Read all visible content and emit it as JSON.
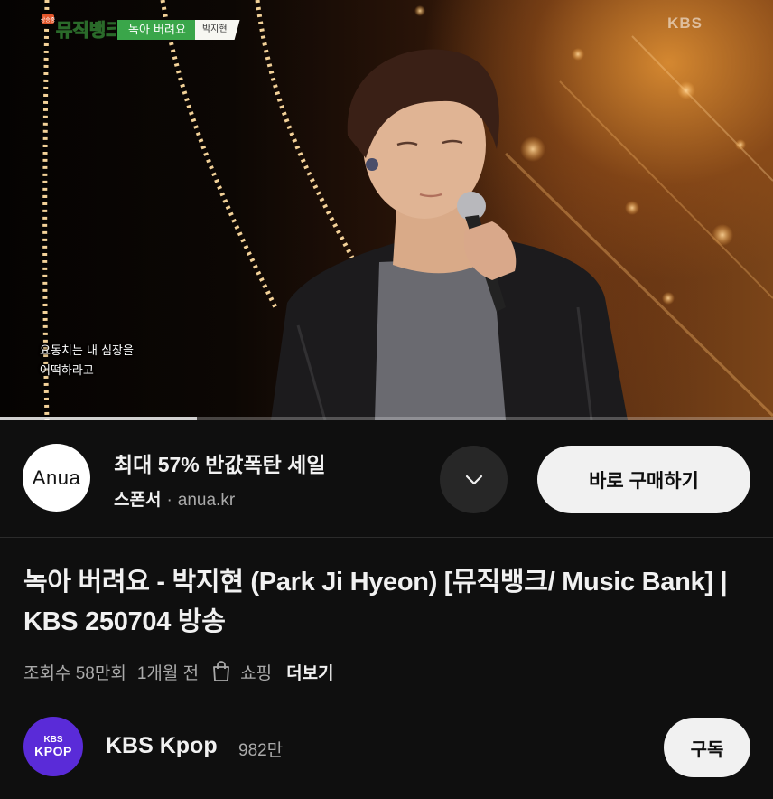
{
  "player": {
    "show_logo_text": "뮤직뱅크",
    "show_logo_badge": "상승중",
    "song_tag_title": "녹아 버려요",
    "song_tag_artist": "박지현",
    "broadcaster_mark": "KBS",
    "lyrics_line1": "요동치는 내 심장을",
    "lyrics_line2": "어떡하라고",
    "progress_fraction": 0.255
  },
  "ad": {
    "logo_text": "Anua",
    "headline": "최대 57% 반값폭탄 세일",
    "sponsor_label": "스폰서",
    "separator": "·",
    "domain": "anua.kr",
    "expand_icon": "chevron-down-icon",
    "cta_label": "바로 구매하기"
  },
  "video": {
    "title": "녹아 버려요 - 박지현 (Park Ji Hyeon) [뮤직뱅크/ Music Bank] | KBS 250704 방송",
    "views": "조회수 58만회",
    "age": "1개월 전",
    "shopping_icon": "shopping-bag-icon",
    "shopping_label": "쇼핑",
    "more_label": "더보기"
  },
  "channel": {
    "avatar_line1": "KBS",
    "avatar_line2": "KPOP",
    "avatar_color": "#5a2bd8",
    "name": "KBS Kpop",
    "subscribers": "982만",
    "subscribe_label": "구독"
  },
  "colors": {
    "background": "#0f0f0f",
    "primary_text": "#f1f1f1",
    "secondary_text": "#aaaaaa",
    "song_tag_green": "#3aa64a",
    "button_light": "#f1f1f1"
  }
}
